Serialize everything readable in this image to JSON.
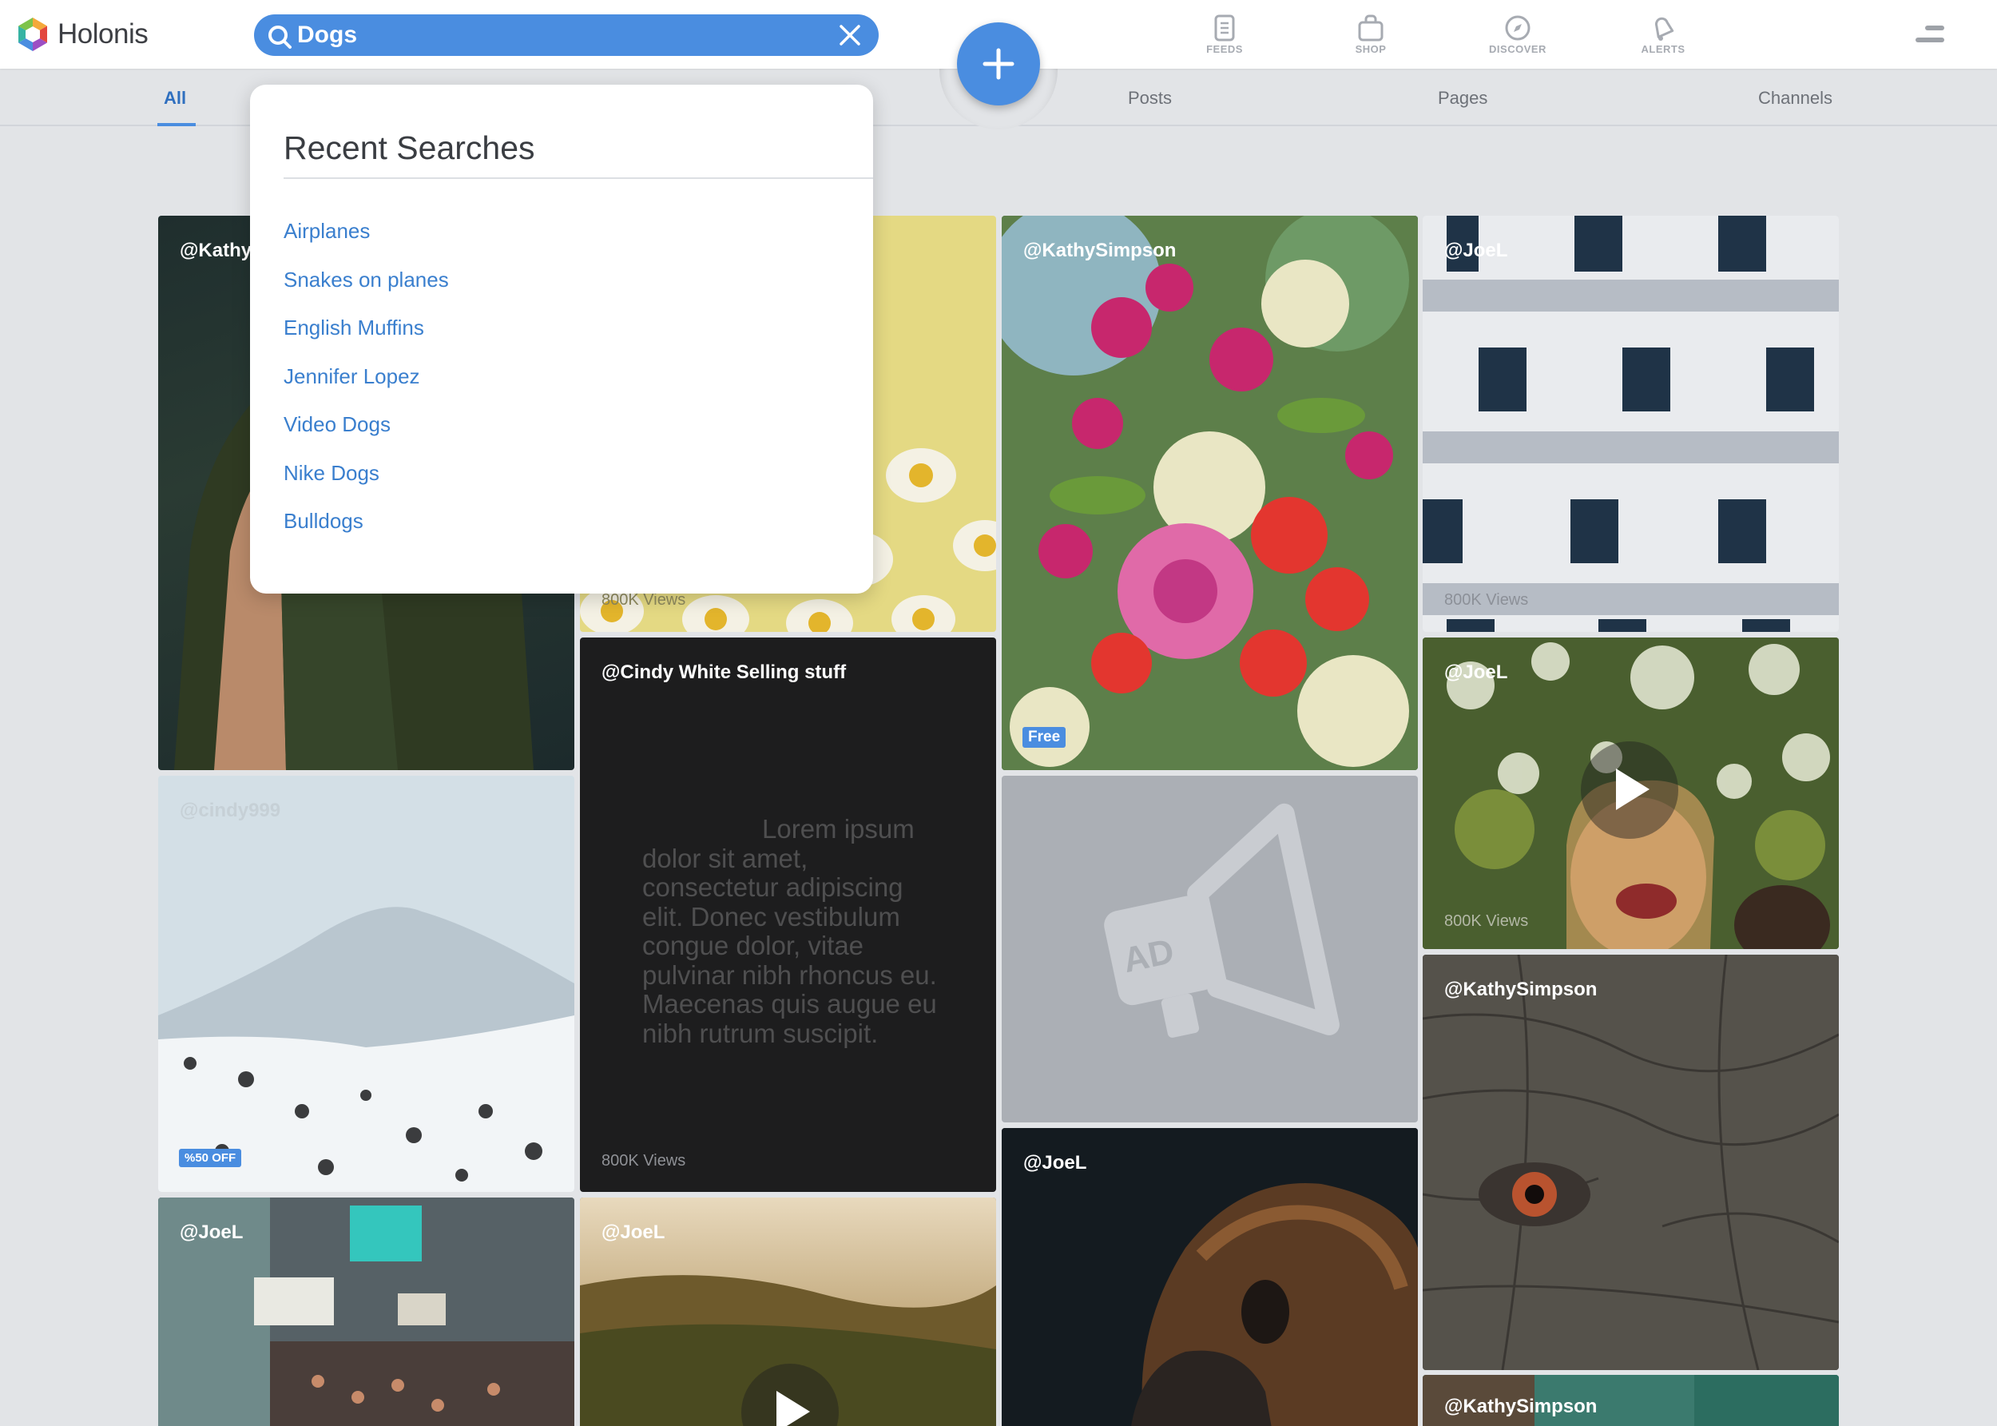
{
  "app": {
    "name": "Holonis"
  },
  "search": {
    "value": "Dogs"
  },
  "nav": {
    "feeds": "FEEDS",
    "shop": "SHOP",
    "discover": "DISCOVER",
    "alerts": "ALERTS"
  },
  "tabs": [
    "All",
    "Posts",
    "Pages",
    "Channels"
  ],
  "recent_searches": {
    "title": "Recent Searches",
    "items": [
      "Airplanes",
      "Snakes on planes",
      "English Muffins",
      "Jennifer Lopez",
      "Video Dogs",
      "Nike Dogs",
      "Bulldogs"
    ]
  },
  "tiles": [
    {
      "handle": "@Kathy"
    },
    {
      "views": "800K Views"
    },
    {
      "handle": "@KathySimpson",
      "badge": "Free"
    },
    {
      "handle": "@JoeL",
      "views": "800K Views"
    },
    {
      "handle": "@Cindy White Selling stuff",
      "body": "Lorem ipsum dolor sit amet, consectetur adipiscing elit. Donec vestibulum congue dolor, vitae pulvinar nibh rhoncus eu. Maecenas quis augue eu nibh rutrum suscipit.",
      "views": "800K Views"
    },
    {
      "handle": "@JoeL",
      "views": "800K Views"
    },
    {
      "handle": "@cindy999",
      "badge": "%50 OFF"
    },
    {
      "ad_label": "AD"
    },
    {
      "handle": "@KathySimpson"
    },
    {
      "handle": "@JoeL"
    },
    {
      "handle": "@JoeL"
    },
    {
      "handle": "@JoeL"
    },
    {
      "handle": "@KathySimpson"
    }
  ],
  "colors": {
    "accent": "#4a8de0",
    "link": "#3a7fce",
    "background": "#e2e4e7",
    "dark_tile": "#1d1d1e",
    "ad_tile": "#abafb5"
  }
}
